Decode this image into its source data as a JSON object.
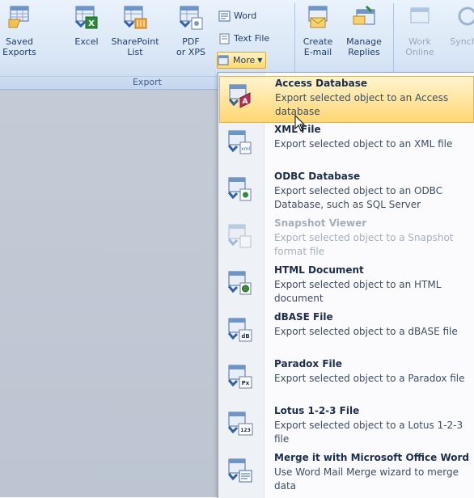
{
  "ribbon": {
    "buttons": {
      "saved_exports": "Saved\nExports",
      "excel": "Excel",
      "sharepoint": "SharePoint\nList",
      "pdf": "PDF\nor XPS",
      "create_email": "Create\nE-mail",
      "manage_replies": "Manage\nReplies",
      "work_online": "Work\nOnline",
      "sync": "Synch"
    },
    "small_buttons": {
      "word": "Word",
      "text_file": "Text File",
      "more": "More"
    },
    "group_label": "Export"
  },
  "menu": {
    "items": [
      {
        "title": "Access Database",
        "desc": "Export selected object to an Access database"
      },
      {
        "title": "XML File",
        "desc": "Export selected object to an XML file"
      },
      {
        "title": "ODBC Database",
        "desc": "Export selected object to an ODBC Database, such as SQL Server"
      },
      {
        "title": "Snapshot Viewer",
        "desc": "Export selected object to a Snapshot format file"
      },
      {
        "title": "HTML Document",
        "desc": "Export selected object to an HTML document"
      },
      {
        "title": "dBASE File",
        "desc": "Export selected object to a dBASE file"
      },
      {
        "title": "Paradox File",
        "desc": "Export selected object to a Paradox file"
      },
      {
        "title": "Lotus 1-2-3 File",
        "desc": "Export selected object to a Lotus 1-2-3 file"
      },
      {
        "title": "Merge it with Microsoft Office Word",
        "desc": "Use Word Mail Merge wizard to merge data"
      }
    ]
  },
  "icons": {
    "saved_exports": "saved-exports-icon",
    "excel": "excel-icon",
    "sharepoint": "sharepoint-icon",
    "pdf": "pdf-icon",
    "create_email": "create-email-icon",
    "manage_replies": "manage-replies-icon",
    "work_online": "work-online-icon"
  },
  "colors": {
    "hover_top": "#fff4cf",
    "hover_bottom": "#ffd772",
    "ribbon": "#dae7f6"
  }
}
